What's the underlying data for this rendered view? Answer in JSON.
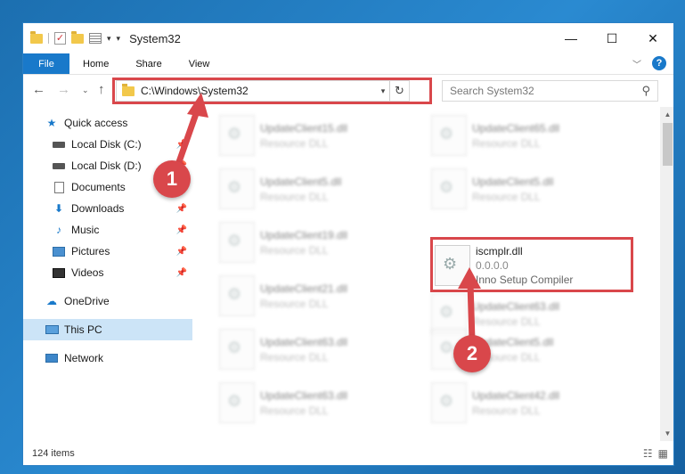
{
  "window": {
    "title": "System32"
  },
  "ribbon": {
    "file": "File",
    "tabs": [
      "Home",
      "Share",
      "View"
    ],
    "help": "?"
  },
  "address": {
    "path": "C:\\Windows\\System32",
    "search_placeholder": "Search System32"
  },
  "sidebar": {
    "items": [
      {
        "label": "Quick access",
        "icon": "star-icon",
        "pinned": false
      },
      {
        "label": "Local Disk (C:)",
        "icon": "drive-icon",
        "pinned": true
      },
      {
        "label": "Local Disk (D:)",
        "icon": "drive-icon",
        "pinned": true
      },
      {
        "label": "Documents",
        "icon": "documents-icon",
        "pinned": true
      },
      {
        "label": "Downloads",
        "icon": "download-icon",
        "pinned": true
      },
      {
        "label": "Music",
        "icon": "music-icon",
        "pinned": true
      },
      {
        "label": "Pictures",
        "icon": "pictures-icon",
        "pinned": true
      },
      {
        "label": "Videos",
        "icon": "videos-icon",
        "pinned": true
      },
      {
        "label": "OneDrive",
        "icon": "cloud-icon",
        "pinned": false
      },
      {
        "label": "This PC",
        "icon": "pc-icon",
        "pinned": false,
        "selected": true
      },
      {
        "label": "Network",
        "icon": "network-icon",
        "pinned": false
      }
    ]
  },
  "files": [
    {
      "name": "UpdateClient15.dll",
      "sub": "Resource DLL"
    },
    {
      "name": "UpdateClient65.dll",
      "sub": "Resource DLL"
    },
    {
      "name": "UpdateClient5.dll",
      "sub": "Resource DLL"
    },
    {
      "name": "UpdateClient5.dll",
      "sub": "Resource DLL"
    },
    {
      "name": "UpdateClient19.dll",
      "sub": "Resource DLL"
    },
    {
      "name": "iscmplr.dll",
      "sub": "0.0.0.0",
      "sub2": "Inno Setup Compiler",
      "highlighted": true
    },
    {
      "name": "UpdateClient21.dll",
      "sub": "Resource DLL"
    },
    {
      "name": "UpdateClient63.dll",
      "sub": "Resource DLL"
    },
    {
      "name": "UpdateClient63.dll",
      "sub": "Resource DLL"
    },
    {
      "name": "UpdateClient5.dll",
      "sub": "Resource DLL"
    },
    {
      "name": "UpdateClient63.dll",
      "sub": "Resource DLL"
    },
    {
      "name": "UpdateClient42.dll",
      "sub": "Resource DLL"
    }
  ],
  "status": {
    "count": "124 items"
  },
  "markers": {
    "one": "1",
    "two": "2"
  },
  "colors": {
    "accent": "#1979ca",
    "annotation": "#d9474b",
    "selected": "#cce4f7"
  }
}
